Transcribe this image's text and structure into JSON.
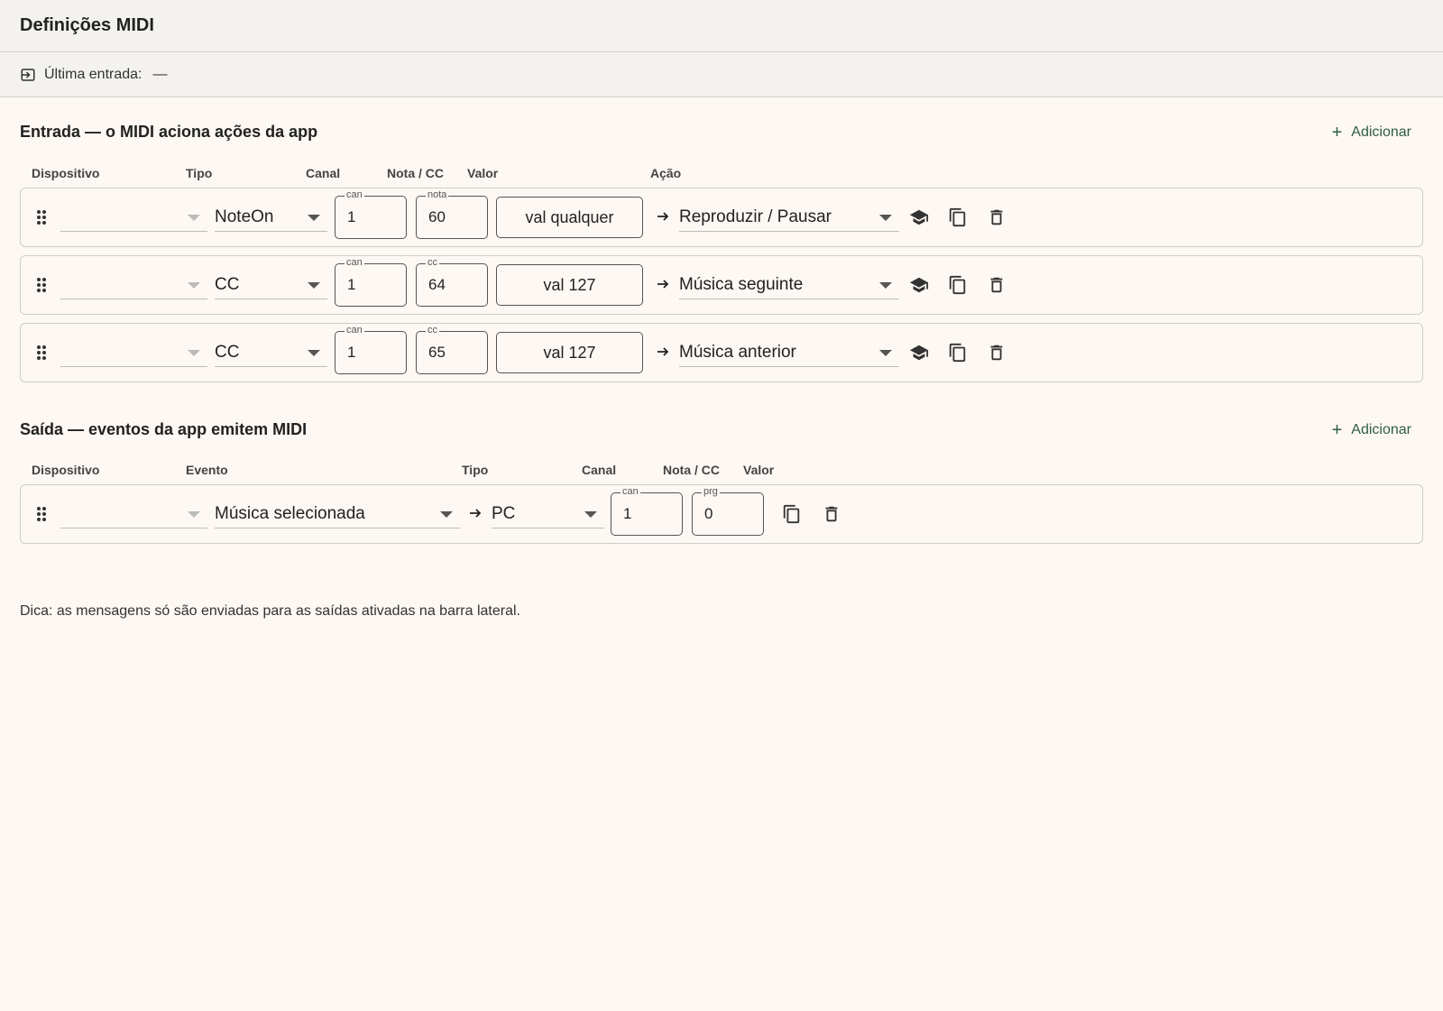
{
  "title": "Definições MIDI",
  "last_input": {
    "label": "Última entrada:",
    "value": "—"
  },
  "input_section": {
    "title": "Entrada — o MIDI aciona ações da app",
    "add_label": "Adicionar",
    "columns": {
      "device": "Dispositivo",
      "type": "Tipo",
      "channel": "Canal",
      "note_cc": "Nota / CC",
      "value": "Valor",
      "action": "Ação"
    },
    "rows": [
      {
        "device": "",
        "type": "NoteOn",
        "channel_label": "can",
        "channel": "1",
        "num_label": "nota",
        "num": "60",
        "value": "val qualquer",
        "action": "Reproduzir / Pausar"
      },
      {
        "device": "",
        "type": "CC",
        "channel_label": "can",
        "channel": "1",
        "num_label": "cc",
        "num": "64",
        "value": "val 127",
        "action": "Música seguinte"
      },
      {
        "device": "",
        "type": "CC",
        "channel_label": "can",
        "channel": "1",
        "num_label": "cc",
        "num": "65",
        "value": "val 127",
        "action": "Música anterior"
      }
    ]
  },
  "output_section": {
    "title": "Saída — eventos da app emitem MIDI",
    "add_label": "Adicionar",
    "columns": {
      "device": "Dispositivo",
      "event": "Evento",
      "type": "Tipo",
      "channel": "Canal",
      "note_cc": "Nota / CC",
      "value": "Valor"
    },
    "rows": [
      {
        "device": "",
        "event": "Música selecionada",
        "type": "PC",
        "channel_label": "can",
        "channel": "1",
        "num_label": "prg",
        "num": "0"
      }
    ]
  },
  "tip": "Dica: as mensagens só são enviadas para as saídas ativadas na barra lateral.",
  "colors": {
    "accent": "#2f5d45",
    "background": "#fdf8f3",
    "header_bg": "#f3f2ee"
  },
  "icons": [
    "input-icon",
    "drag-handle-icon",
    "learn-icon",
    "copy-icon",
    "delete-icon",
    "arrow-right-icon",
    "plus-icon"
  ]
}
